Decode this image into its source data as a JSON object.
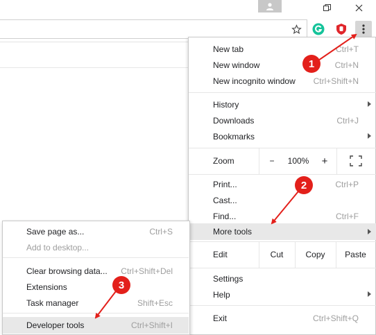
{
  "titlebar": {
    "user_icon": "user-icon",
    "restore_icon": "restore-icon",
    "close_icon": "close-icon"
  },
  "toolbar": {
    "star_icon": "star-icon",
    "grammarly_icon": "grammarly-extension-icon",
    "opera_icon": "adblock-extension-icon",
    "menu_icon": "three-dots-menu-icon",
    "grammarly_color": "#15c39a",
    "opera_color": "#e0262b"
  },
  "menu": {
    "new_tab": {
      "label": "New tab",
      "shortcut": "Ctrl+T"
    },
    "new_window": {
      "label": "New window",
      "shortcut": "Ctrl+N"
    },
    "new_incognito": {
      "label": "New incognito window",
      "shortcut": "Ctrl+Shift+N"
    },
    "history": {
      "label": "History"
    },
    "downloads": {
      "label": "Downloads",
      "shortcut": "Ctrl+J"
    },
    "bookmarks": {
      "label": "Bookmarks"
    },
    "zoom": {
      "label": "Zoom",
      "minus": "−",
      "value": "100%",
      "plus": "+"
    },
    "print": {
      "label": "Print...",
      "shortcut": "Ctrl+P"
    },
    "cast": {
      "label": "Cast..."
    },
    "find": {
      "label": "Find...",
      "shortcut": "Ctrl+F"
    },
    "more_tools": {
      "label": "More tools"
    },
    "edit": {
      "label": "Edit",
      "cut": "Cut",
      "copy": "Copy",
      "paste": "Paste"
    },
    "settings": {
      "label": "Settings"
    },
    "help": {
      "label": "Help"
    },
    "exit": {
      "label": "Exit",
      "shortcut": "Ctrl+Shift+Q"
    }
  },
  "submenu": {
    "save_page": {
      "label": "Save page as...",
      "shortcut": "Ctrl+S"
    },
    "add_desktop": {
      "label": "Add to desktop..."
    },
    "clear_data": {
      "label": "Clear browsing data...",
      "shortcut": "Ctrl+Shift+Del"
    },
    "extensions": {
      "label": "Extensions"
    },
    "task_manager": {
      "label": "Task manager",
      "shortcut": "Shift+Esc"
    },
    "dev_tools": {
      "label": "Developer tools",
      "shortcut": "Ctrl+Shift+I"
    }
  },
  "annotations": {
    "step1": "1",
    "step2": "2",
    "step3": "3",
    "color": "#e3201b"
  }
}
